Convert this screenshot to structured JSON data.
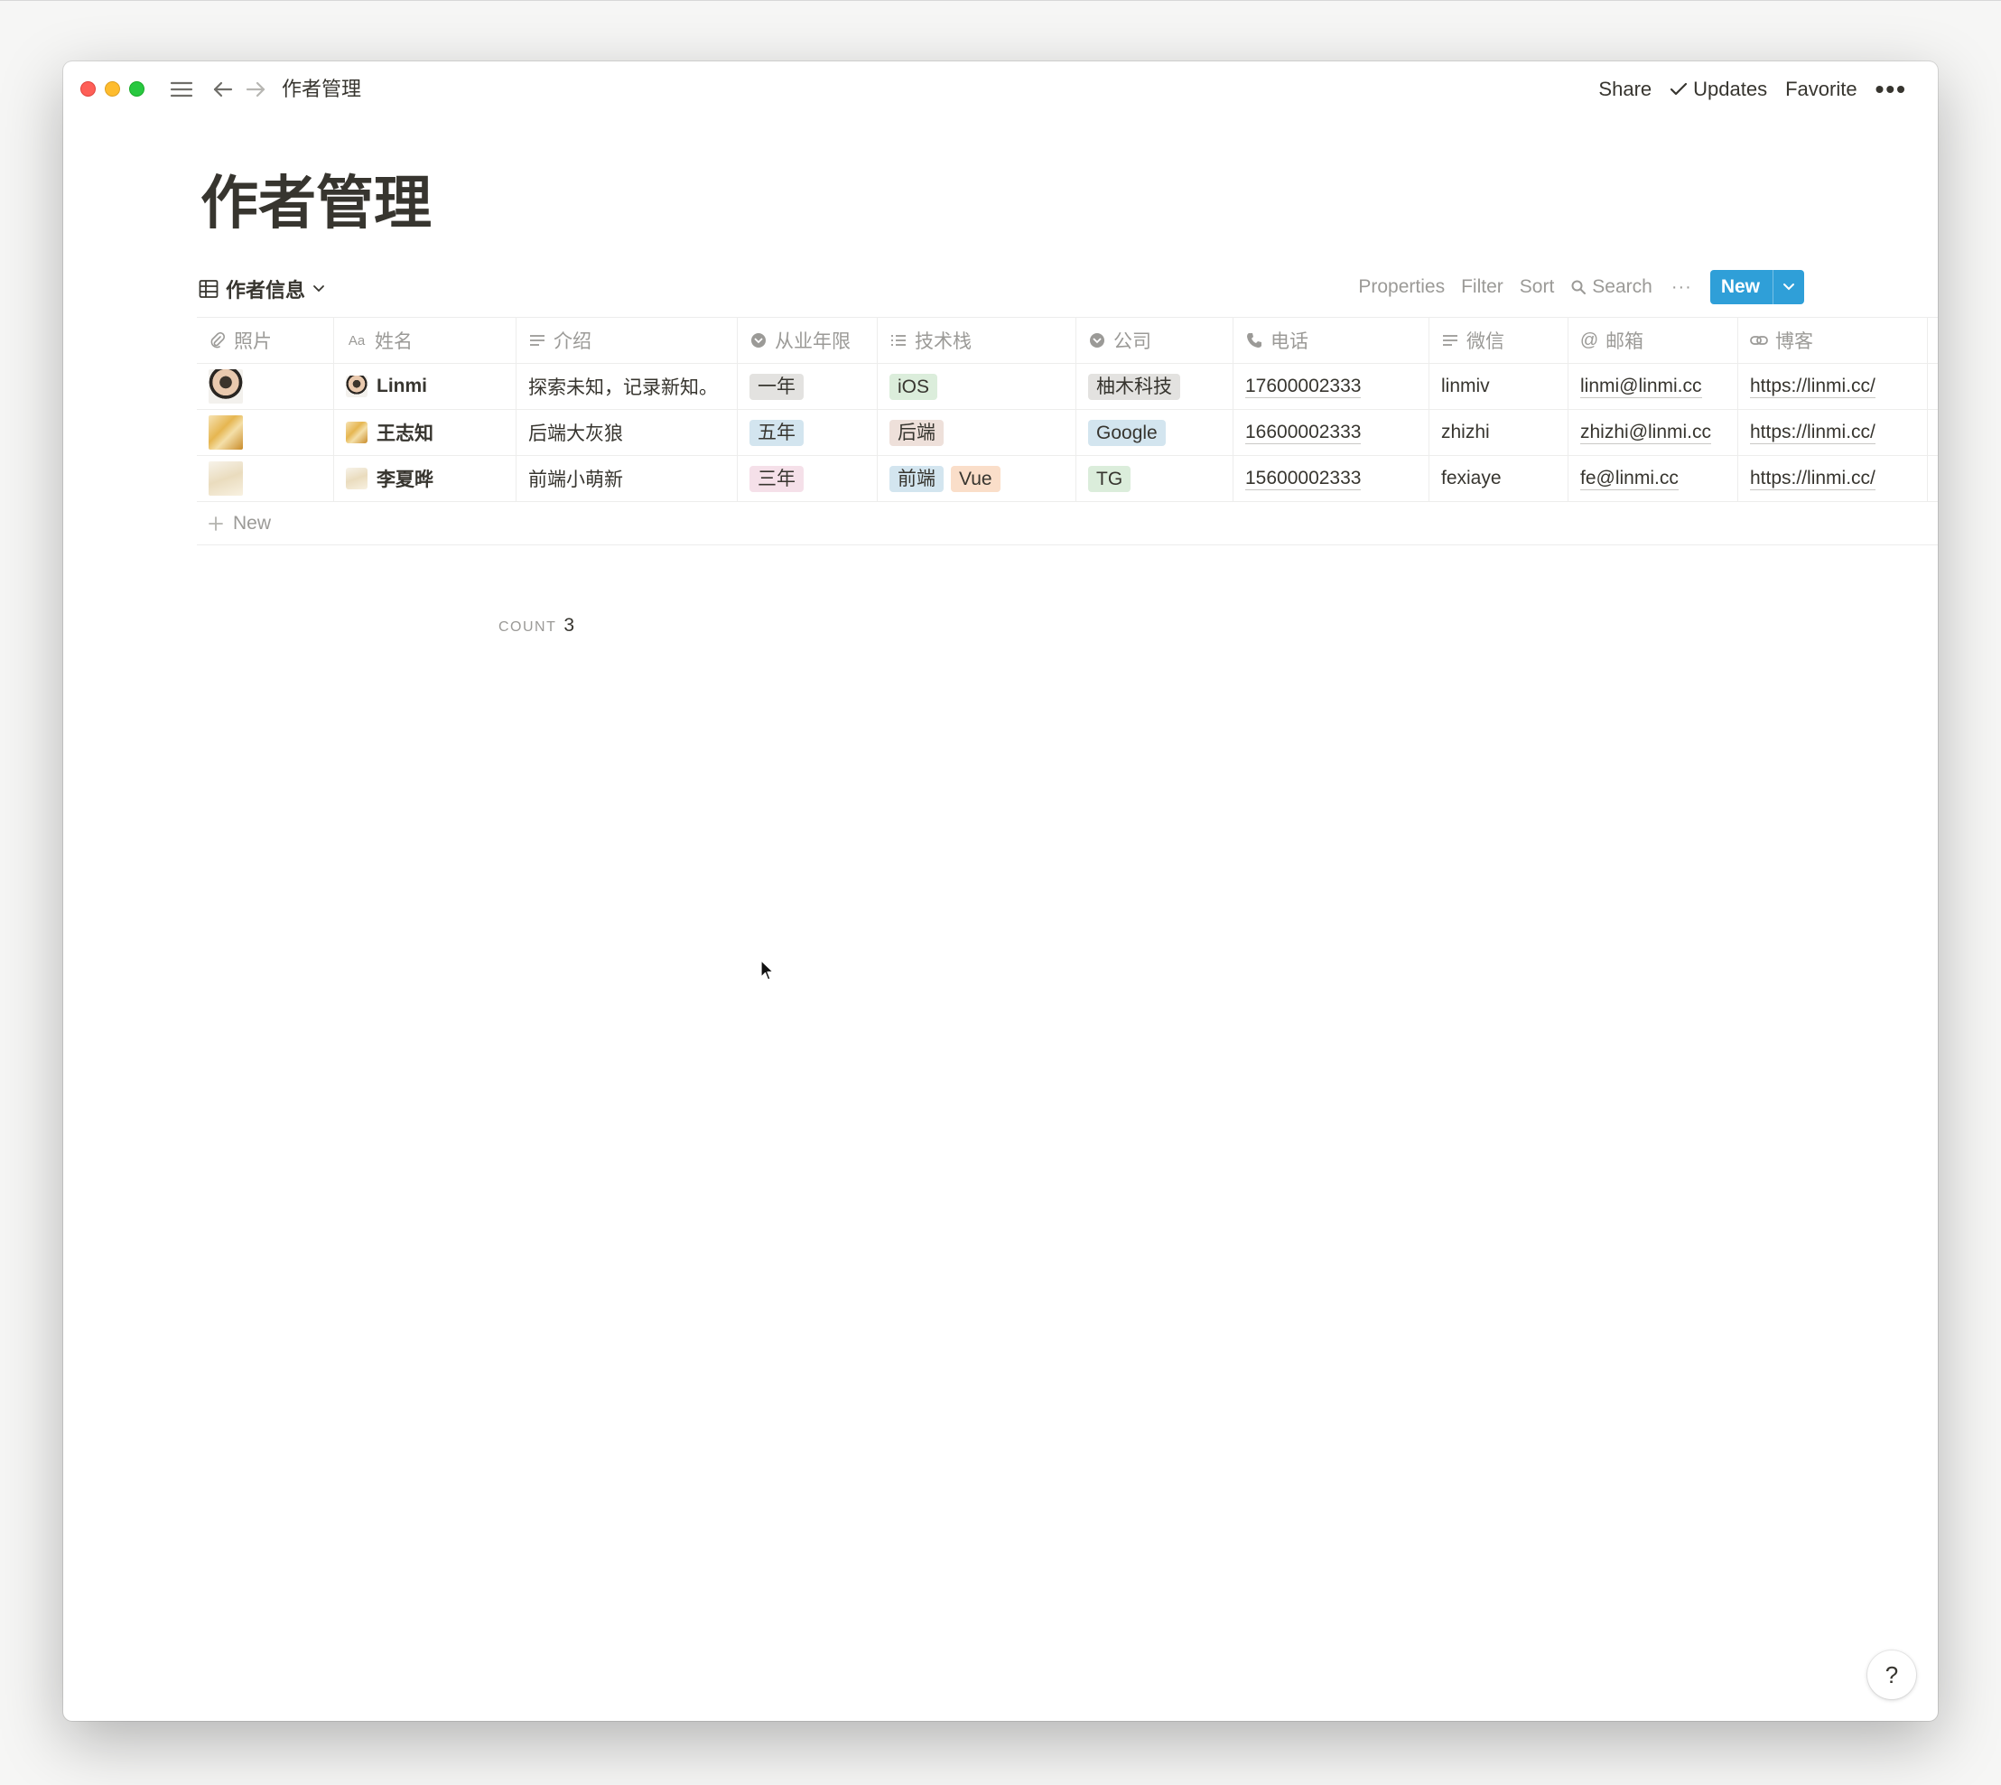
{
  "topbar": {
    "breadcrumb": "作者管理",
    "share": "Share",
    "updates": "Updates",
    "favorite": "Favorite",
    "more": "•••"
  },
  "page": {
    "title": "作者管理"
  },
  "view": {
    "name": "作者信息",
    "actions": {
      "properties": "Properties",
      "filter": "Filter",
      "sort": "Sort",
      "search": "Search",
      "more": "···",
      "new": "New"
    }
  },
  "table": {
    "columns": [
      "照片",
      "姓名",
      "介绍",
      "从业年限",
      "技术栈",
      "公司",
      "电话",
      "微信",
      "邮箱",
      "博客"
    ],
    "rows": [
      {
        "name": "Linmi",
        "intro": "探索未知，记录新知。",
        "years": "一年",
        "stack": [
          "iOS"
        ],
        "company": "柚木科技",
        "phone": "17600002333",
        "wechat": "linmiv",
        "email": "linmi@linmi.cc",
        "blog": "https://linmi.cc/"
      },
      {
        "name": "王志知",
        "intro": "后端大灰狼",
        "years": "五年",
        "stack": [
          "后端"
        ],
        "company": "Google",
        "phone": "16600002333",
        "wechat": "zhizhi",
        "email": "zhizhi@linmi.cc",
        "blog": "https://linmi.cc/"
      },
      {
        "name": "李夏晔",
        "intro": "前端小萌新",
        "years": "三年",
        "stack": [
          "前端",
          "Vue"
        ],
        "company": "TG",
        "phone": "15600002333",
        "wechat": "fexiaye",
        "email": "fe@linmi.cc",
        "blog": "https://linmi.cc/"
      }
    ],
    "new_row": "New",
    "count_label": "COUNT",
    "count_value": "3"
  },
  "help": "?",
  "colors": {
    "accent": "#2f9fd8",
    "tag_gray": "#e3e2e0",
    "tag_blue": "#d3e5ef",
    "tag_pink": "#f5e0e9",
    "tag_teal": "#dbeddb",
    "tag_brown": "#eee0da",
    "tag_orange": "#fadec9"
  }
}
